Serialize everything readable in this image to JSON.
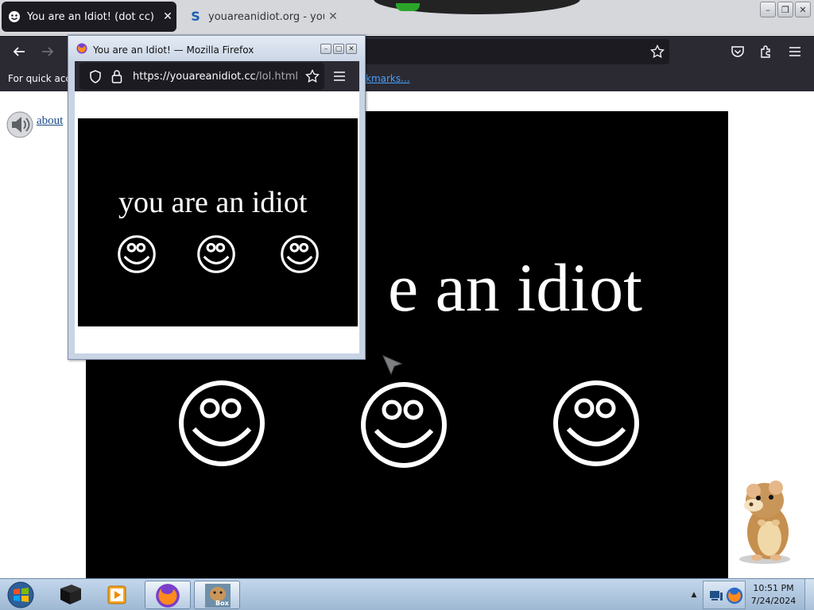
{
  "browser": {
    "tabs": [
      {
        "title": "You are an Idiot! (dot cc)",
        "active": true,
        "close_glyph": "✕"
      },
      {
        "title": "youareanidiot.org - youareanidi",
        "active": false,
        "close_glyph": "✕",
        "favicon_glyph": "S"
      }
    ],
    "bookmarks_bar": {
      "text": "For quick acce",
      "link": "kmarks..."
    }
  },
  "page": {
    "about_link": "about",
    "headline": "e an idiot"
  },
  "popup": {
    "title": "You are an Idiot! — Mozilla Firefox",
    "url_host": "https://youareanidiot.cc",
    "url_path": "/lol.html",
    "headline": "you are an idiot"
  },
  "taskbar": {
    "time": "10:51 PM",
    "date": "7/24/2024",
    "box_label": "Box"
  },
  "colors": {
    "tab_active_bg": "#1c1b22",
    "toolbar_bg": "#2b2a33",
    "link_blue": "#45a1ff",
    "stage_bg": "#000000",
    "taskbar": "#b3cbe4"
  },
  "icons": [
    "firefox-icon",
    "speaker-icon",
    "smiley-icon",
    "shield-icon",
    "lock-icon",
    "star-icon",
    "menu-icon",
    "back-icon",
    "forward-icon",
    "pocket-icon",
    "extensions-icon",
    "windows-start-icon",
    "media-player-icon",
    "hamster-icon"
  ]
}
